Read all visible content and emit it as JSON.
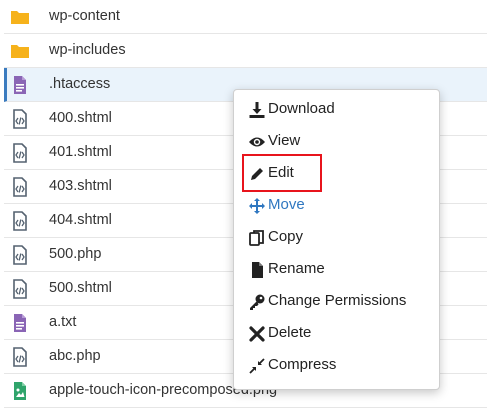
{
  "files": [
    {
      "name": "wp-content",
      "icon": "folder-icon"
    },
    {
      "name": "wp-includes",
      "icon": "folder-icon"
    },
    {
      "name": ".htaccess",
      "icon": "text-file-icon"
    },
    {
      "name": "400.shtml",
      "icon": "code-file-icon"
    },
    {
      "name": "401.shtml",
      "icon": "code-file-icon"
    },
    {
      "name": "403.shtml",
      "icon": "code-file-icon"
    },
    {
      "name": "404.shtml",
      "icon": "code-file-icon"
    },
    {
      "name": "500.php",
      "icon": "code-file-icon"
    },
    {
      "name": "500.shtml",
      "icon": "code-file-icon"
    },
    {
      "name": "a.txt",
      "icon": "text-file-icon"
    },
    {
      "name": "abc.php",
      "icon": "code-file-icon"
    },
    {
      "name": "apple-touch-icon-precomposed.png",
      "icon": "image-file-icon"
    }
  ],
  "selected_file": ".htaccess",
  "context_menu": {
    "items": [
      {
        "label": "Download",
        "icon": "download-icon"
      },
      {
        "label": "View",
        "icon": "eye-icon"
      },
      {
        "label": "Edit",
        "icon": "pencil-icon",
        "highlighted": true
      },
      {
        "label": "Move",
        "icon": "move-arrows-icon"
      },
      {
        "label": "Copy",
        "icon": "copy-icon"
      },
      {
        "label": "Rename",
        "icon": "document-icon"
      },
      {
        "label": "Change Permissions",
        "icon": "key-icon"
      },
      {
        "label": "Delete",
        "icon": "close-x-icon"
      },
      {
        "label": "Compress",
        "icon": "compress-icon"
      }
    ]
  },
  "colors": {
    "folder": "#f6b21b",
    "text_file": "#8a65b5",
    "code_file": "#556270",
    "image_file": "#2fa46b",
    "selection": "#eaf3fb",
    "accent": "#2f77c0",
    "highlight_box": "#e8141c"
  }
}
